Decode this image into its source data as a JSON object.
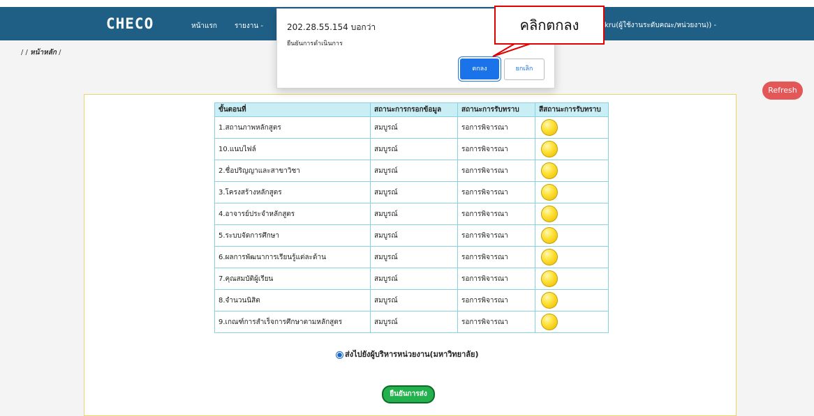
{
  "navbar": {
    "logo": "CHECO",
    "home_link": "หน้าแรก",
    "report_link": "รายงาน -",
    "user_text": "kru(ผู้ใช้งานระดับคณะ/หน่วยงาน)) -"
  },
  "breadcrumb": {
    "text_prefix": "/   /",
    "current": "หน้าหลัก",
    "suffix": "/"
  },
  "refresh_label": "Refresh",
  "table": {
    "headers": [
      "ขั้นตอนที่",
      "สถานะการกรอกข้อมูล",
      "สถานะการรับทราบ",
      "สีสถานะการรับทราบ"
    ],
    "rows": [
      {
        "step": "1.สถานภาพหลักสูตร",
        "fill": "สมบูรณ์",
        "ack": "รอการพิจารณา"
      },
      {
        "step": "10.แนบไฟล์",
        "fill": "สมบูรณ์",
        "ack": "รอการพิจารณา"
      },
      {
        "step": "2.ชื่อปริญญาและสาขาวิชา",
        "fill": "สมบูรณ์",
        "ack": "รอการพิจารณา"
      },
      {
        "step": "3.โครงสร้างหลักสูตร",
        "fill": "สมบูรณ์",
        "ack": "รอการพิจารณา"
      },
      {
        "step": "4.อาจารย์ประจำหลักสูตร",
        "fill": "สมบูรณ์",
        "ack": "รอการพิจารณา"
      },
      {
        "step": "5.ระบบจัดการศึกษา",
        "fill": "สมบูรณ์",
        "ack": "รอการพิจารณา"
      },
      {
        "step": "6.ผลการพัฒนาการเรียนรู้แต่ละด้าน",
        "fill": "สมบูรณ์",
        "ack": "รอการพิจารณา"
      },
      {
        "step": "7.คุณสมบัติผู้เรียน",
        "fill": "สมบูรณ์",
        "ack": "รอการพิจารณา"
      },
      {
        "step": "8.จำนวนนิสิต",
        "fill": "สมบูรณ์",
        "ack": "รอการพิจารณา"
      },
      {
        "step": "9.เกณฑ์การสำเร็จการศึกษาตามหลักสูตร",
        "fill": "สมบูรณ์",
        "ack": "รอการพิจารณา"
      }
    ]
  },
  "send_option_label": "ส่งไปยังผู้บริหารหน่วยงาน(มหาวิทยาลัย)",
  "confirm_send_label": "ยืนยันการส่ง",
  "dialog": {
    "title": "202.28.55.154 บอกว่า",
    "message": "ยืนยันการดำเนินการ",
    "ok_label": "ตกลง",
    "cancel_label": "ยกเลิก"
  },
  "callout_text": "คลิกตกลง",
  "colors": {
    "navbar": "#1f5f86",
    "status_light": "#ffe23a",
    "ok_button": "#1a73e8",
    "callout_border": "#e00000"
  }
}
